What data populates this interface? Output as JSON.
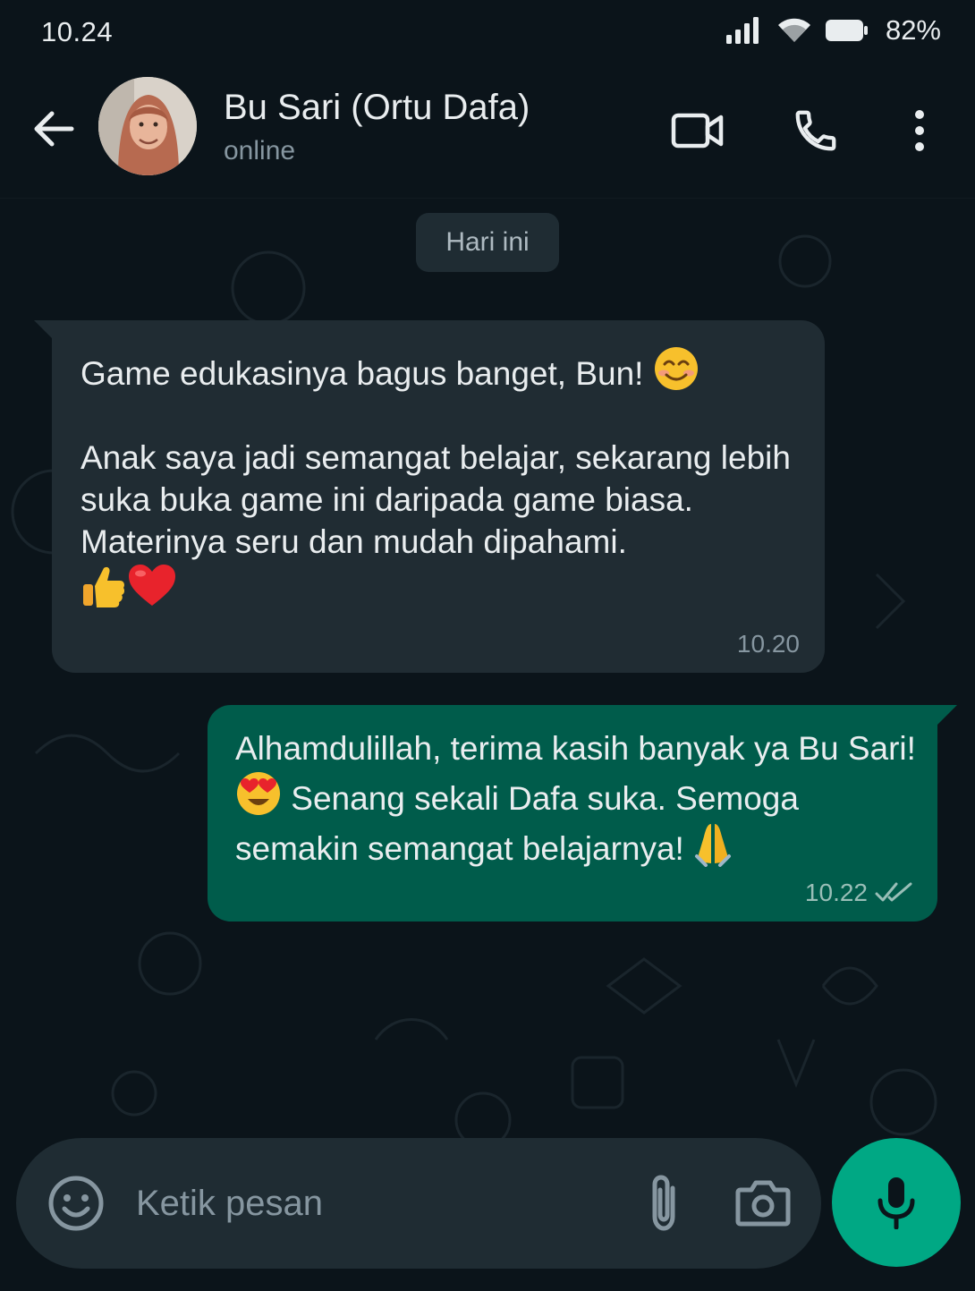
{
  "status_bar": {
    "time": "10.24",
    "battery_percent": "82%"
  },
  "header": {
    "contact_name": "Bu Sari (Ortu Dafa)",
    "contact_status": "online"
  },
  "chat": {
    "date_chip": "Hari ini",
    "messages": [
      {
        "direction": "incoming",
        "line1": "Game edukasinya bagus banget, Bun!",
        "body": "Anak saya jadi semangat belajar, sekarang lebih suka buka game ini daripada game biasa. Materinya seru dan mudah dipahami.",
        "emojis": [
          "smiling-face",
          "thumbs-up",
          "red-heart"
        ],
        "time": "10.20"
      },
      {
        "direction": "outgoing",
        "part1": "Alhamdulillah, terima kasih banyak ya Bu Sari!",
        "part2": "Senang sekali Dafa suka. Semoga semakin semangat belajarnya!",
        "emojis": [
          "heart-eyes",
          "folded-hands"
        ],
        "time": "10.22",
        "status": "read"
      }
    ]
  },
  "composer": {
    "placeholder": "Ketik pesan"
  },
  "colors": {
    "background": "#0b141a",
    "incoming_bubble": "#202c33",
    "outgoing_bubble": "#005c4b",
    "accent": "#00a884"
  }
}
